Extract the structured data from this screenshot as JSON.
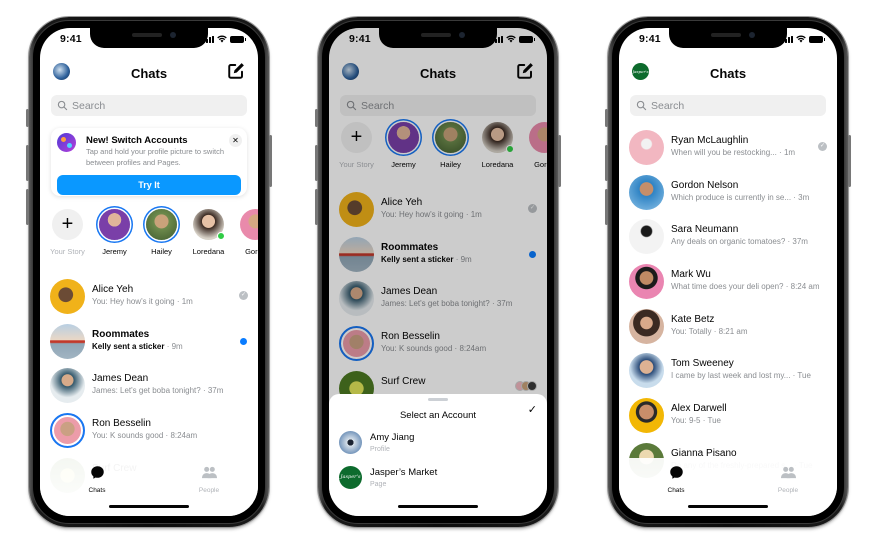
{
  "phones": [
    {
      "status_time": "9:41",
      "header_title": "Chats",
      "search_placeholder": "Search",
      "promo": {
        "title": "New! Switch Accounts",
        "description": "Tap and hold your profile picture to switch between profiles and Pages.",
        "button": "Try It",
        "close_glyph": "✕"
      },
      "stories": [
        {
          "label": "Your Story",
          "type": "add",
          "glyph": "+"
        },
        {
          "label": "Jeremy",
          "ring": true
        },
        {
          "label": "Hailey",
          "ring": true
        },
        {
          "label": "Loredana",
          "online": true
        },
        {
          "label": "Gordo"
        }
      ],
      "chats": [
        {
          "name": "Alice Yeh",
          "preview": "You: Hey how's it going",
          "time": "1m",
          "status": "seen"
        },
        {
          "name": "Roommates",
          "preview": "Kelly sent a sticker",
          "time": "9m",
          "status": "unread",
          "bold": true
        },
        {
          "name": "James Dean",
          "preview": "James: Let's get boba tonight?",
          "time": "37m"
        },
        {
          "name": "Ron Besselin",
          "preview": "You: K sounds good",
          "time": "8:24am",
          "ring": true
        },
        {
          "name": "Surf Crew",
          "preview": "",
          "time": ""
        }
      ],
      "tabs": [
        {
          "label": "Chats",
          "active": true
        },
        {
          "label": "People",
          "active": false
        }
      ]
    },
    {
      "status_time": "9:41",
      "header_title": "Chats",
      "search_placeholder": "Search",
      "stories": [
        {
          "label": "Your Story",
          "type": "add",
          "glyph": "+"
        },
        {
          "label": "Jeremy",
          "ring": true
        },
        {
          "label": "Hailey",
          "ring": true
        },
        {
          "label": "Loredana",
          "online": true
        },
        {
          "label": "Gordo"
        }
      ],
      "chats": [
        {
          "name": "Alice Yeh",
          "preview": "You: Hey how's it going",
          "time": "1m",
          "status": "seen"
        },
        {
          "name": "Roommates",
          "preview": "Kelly sent a sticker",
          "time": "9m",
          "status": "unread",
          "bold": true
        },
        {
          "name": "James Dean",
          "preview": "James: Let's get boba tonight?",
          "time": "37m"
        },
        {
          "name": "Ron Besselin",
          "preview": "You: K sounds good",
          "time": "8:24am",
          "ring": true
        },
        {
          "name": "Surf Crew",
          "preview": "",
          "time": ""
        }
      ],
      "account_sheet": {
        "title": "Select an Account",
        "check_glyph": "✓",
        "accounts": [
          {
            "name": "Amy Jiang",
            "type": "Profile"
          },
          {
            "name": "Jasper’s Market",
            "type": "Page",
            "logo_text": "Jasper's"
          }
        ]
      }
    },
    {
      "status_time": "9:41",
      "header_title": "Chats",
      "search_placeholder": "Search",
      "page_logo_text": "Jasper's",
      "chats": [
        {
          "name": "Ryan McLaughlin",
          "preview": "When will you be restocking...",
          "time": "1m",
          "status": "seen"
        },
        {
          "name": "Gordon Nelson",
          "preview": "Which produce is currently in se...",
          "time": "3m"
        },
        {
          "name": "Sara Neumann",
          "preview": "Any deals on organic tomatoes?",
          "time": "37m"
        },
        {
          "name": "Mark Wu",
          "preview": "What time does your deli open?",
          "time": "8:24 am"
        },
        {
          "name": "Kate Betz",
          "preview": "You: Totally",
          "time": "8:21 am"
        },
        {
          "name": "Tom Sweeney",
          "preview": "I came by last week and lost my...",
          "time": "Tue"
        },
        {
          "name": "Alex Darwell",
          "preview": "You: 9-5",
          "time": "Tue"
        },
        {
          "name": "Gianna Pisano",
          "preview": "Do any of the freshly-prepared s...",
          "time": "Tue"
        }
      ],
      "tabs": [
        {
          "label": "Chats",
          "active": true
        },
        {
          "label": "People",
          "active": false
        }
      ]
    }
  ],
  "separator": " · ",
  "colors": {
    "accent_blue": "#0a98ff",
    "unread_dot": "#0a7cff",
    "story_ring": "#1877f2",
    "online_green": "#31cc46",
    "muted_text": "#8a8d91",
    "page_green": "#0d6b2d"
  }
}
